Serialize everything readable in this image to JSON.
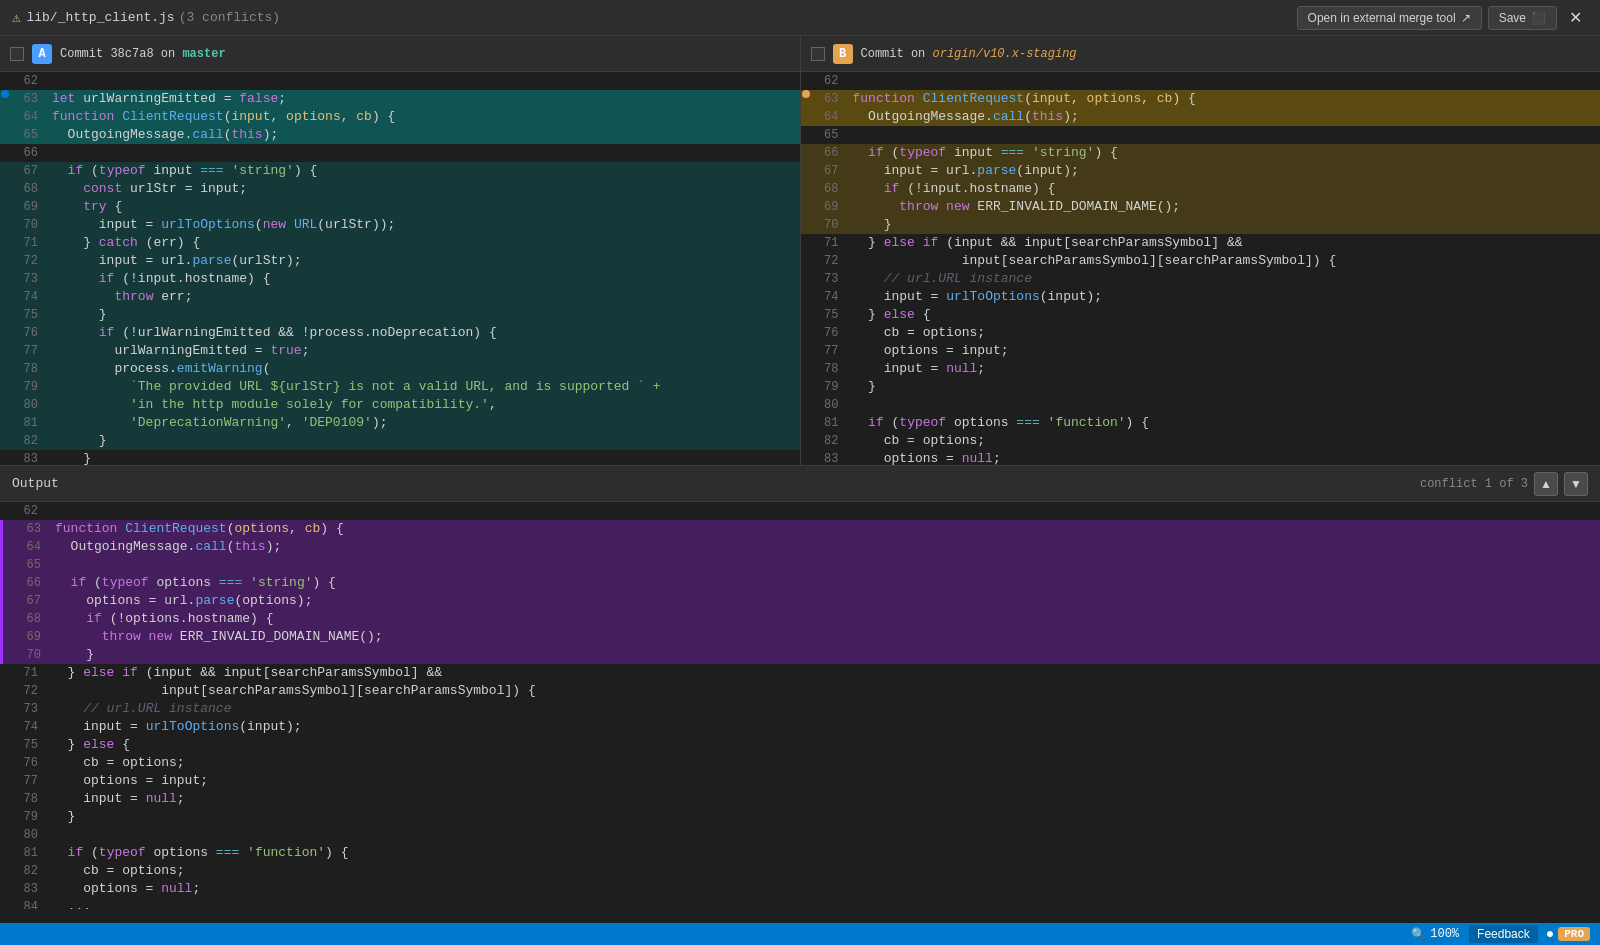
{
  "titleBar": {
    "warningIcon": "⚠",
    "fileName": "lib/_http_client.js",
    "conflictsCount": "(3 conflicts)",
    "externalMergeLabel": "Open in external merge tool",
    "externalMergeIcon": "↗",
    "saveLabel": "Save",
    "saveIcon": "💾",
    "closeIcon": "✕"
  },
  "paneA": {
    "badge": "A",
    "commitLabel": "Commit 38c7a8 on",
    "branchName": "master"
  },
  "paneB": {
    "badge": "B",
    "commitLabel": "Commit on",
    "branchName": "origin/v10.x-staging"
  },
  "output": {
    "label": "Output",
    "conflictText": "conflict 1 of 3",
    "navUpIcon": "▲",
    "navDownIcon": "▼"
  },
  "statusBar": {
    "zoomIcon": "🔍",
    "zoomLevel": "100%",
    "feedbackLabel": "Feedback",
    "dotIcon": "●",
    "proLabel": "PRO"
  }
}
